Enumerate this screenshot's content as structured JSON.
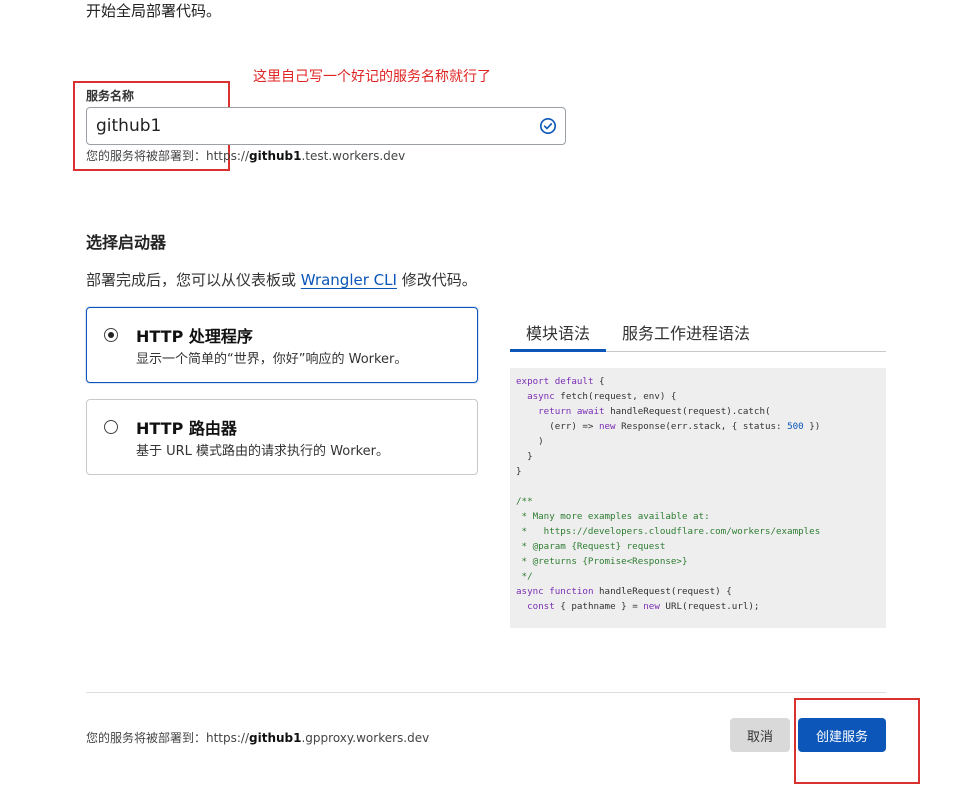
{
  "intro_text": "开始全局部署代码。",
  "annotation": {
    "note": "这里自己写一个好记的服务名称就行了",
    "color": "#e02424"
  },
  "service_name": {
    "label": "服务名称",
    "value": "github1",
    "valid_icon": "check-circle-icon",
    "hint_prefix": "您的服务将被部署到：https://",
    "hint_name": "github1",
    "hint_suffix": ".test.workers.dev"
  },
  "starter": {
    "title": "选择启动器",
    "desc_prefix": "部署完成后，您可以从仪表板或 ",
    "desc_link": "Wrangler CLI",
    "desc_suffix": " 修改代码。",
    "options": [
      {
        "title": "HTTP 处理程序",
        "desc": "显示一个简单的“世界，你好”响应的 Worker。",
        "selected": true
      },
      {
        "title": "HTTP 路由器",
        "desc": "基于 URL 模式路由的请求执行的 Worker。",
        "selected": false
      }
    ]
  },
  "code_tabs": [
    {
      "label": "模块语法",
      "active": true
    },
    {
      "label": "服务工作进程语法",
      "active": false
    }
  ],
  "code_lines": [
    "export default {",
    "  async fetch(request, env) {",
    "    return await handleRequest(request).catch(",
    "      (err) => new Response(err.stack, { status: 500 })",
    "    )",
    "  }",
    "}",
    "",
    "/**",
    " * Many more examples available at:",
    " *   https://developers.cloudflare.com/workers/examples",
    " * @param {Request} request",
    " * @returns {Promise<Response>}",
    " */",
    "async function handleRequest(request) {",
    "  const { pathname } = new URL(request.url);"
  ],
  "footer": {
    "hint_prefix": "您的服务将被部署到：https://",
    "hint_name": "github1",
    "hint_suffix": ".gpproxy.workers.dev",
    "cancel_label": "取消",
    "create_label": "创建服务"
  },
  "colors": {
    "accent": "#0b56b8",
    "code_keyword": "#7a2fb5",
    "code_comment": "#2e7d32",
    "code_number": "#0b56b8"
  }
}
